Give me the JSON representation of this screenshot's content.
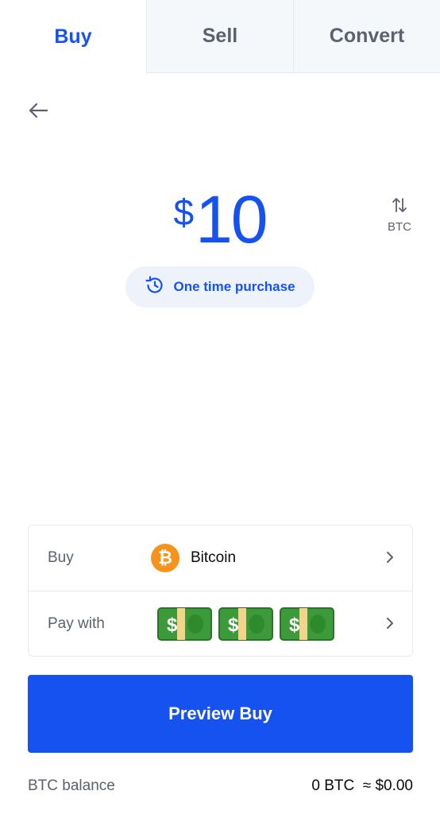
{
  "tabs": [
    {
      "label": "Buy",
      "active": true
    },
    {
      "label": "Sell",
      "active": false
    },
    {
      "label": "Convert",
      "active": false
    }
  ],
  "amount": {
    "currency_symbol": "$",
    "value": "10"
  },
  "unit_toggle": {
    "label": "BTC",
    "icon": "swap-arrows-icon"
  },
  "frequency": {
    "label": "One time purchase",
    "icon": "clock-repeat-icon"
  },
  "order": {
    "buy_row": {
      "label": "Buy",
      "asset_name": "Bitcoin",
      "asset_icon_glyph": "₿"
    },
    "pay_row": {
      "label": "Pay with",
      "payment_icons": [
        "money-icon",
        "money-icon",
        "money-icon"
      ]
    }
  },
  "preview_button": {
    "label": "Preview Buy"
  },
  "balance": {
    "label": "BTC balance",
    "value": "0 BTC  ≈ $0.00"
  },
  "colors": {
    "accent": "#1652f0",
    "bitcoin": "#f7931a",
    "muted": "#5b616e"
  }
}
